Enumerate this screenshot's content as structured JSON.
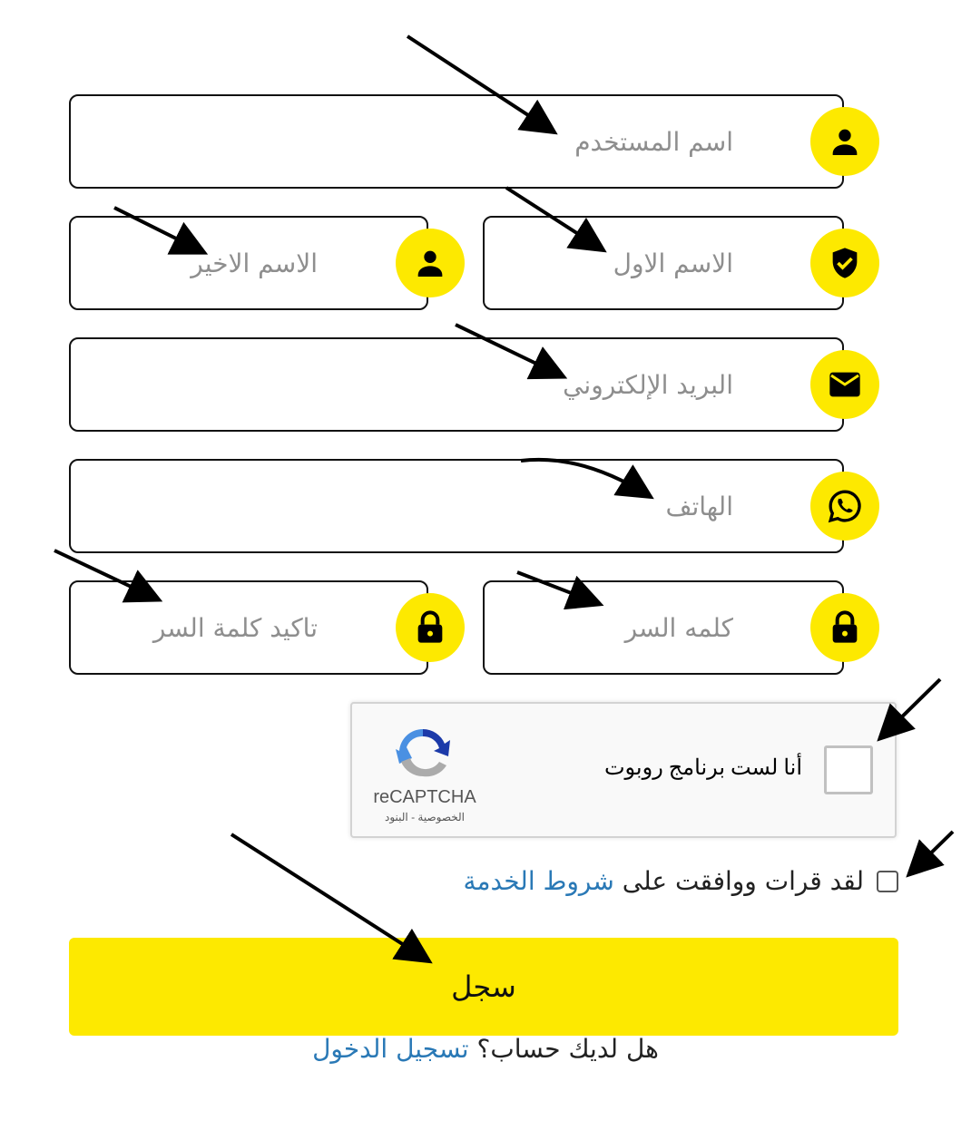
{
  "form": {
    "username_placeholder": "اسم المستخدم",
    "first_name_placeholder": "الاسم الاول",
    "last_name_placeholder": "الاسم الاخير",
    "email_placeholder": "البريد الإلكتروني",
    "phone_placeholder": "الهاتف",
    "password_placeholder": "كلمه السر",
    "confirm_password_placeholder": "تاكيد كلمة السر"
  },
  "icons": {
    "username": "user-icon",
    "first_name": "shield-check-icon",
    "last_name": "user-icon",
    "email": "envelope-icon",
    "phone": "whatsapp-icon",
    "password": "lock-icon",
    "confirm_password": "lock-icon",
    "accent_color": "#fde900"
  },
  "recaptcha": {
    "label": "أنا لست برنامج روبوت",
    "brand": "reCAPTCHA",
    "privacy": "الخصوصية",
    "separator": " - ",
    "terms": "البنود"
  },
  "terms": {
    "text": "لقد قرات ووافقت على",
    "link": "شروط الخدمة"
  },
  "submit": {
    "label": "سجل"
  },
  "login": {
    "text": "هل لديك حساب؟",
    "link": "تسجيل الدخول"
  },
  "colors": {
    "accent": "#fde900",
    "link": "#2a79b6",
    "placeholder": "#8e8e8e"
  }
}
